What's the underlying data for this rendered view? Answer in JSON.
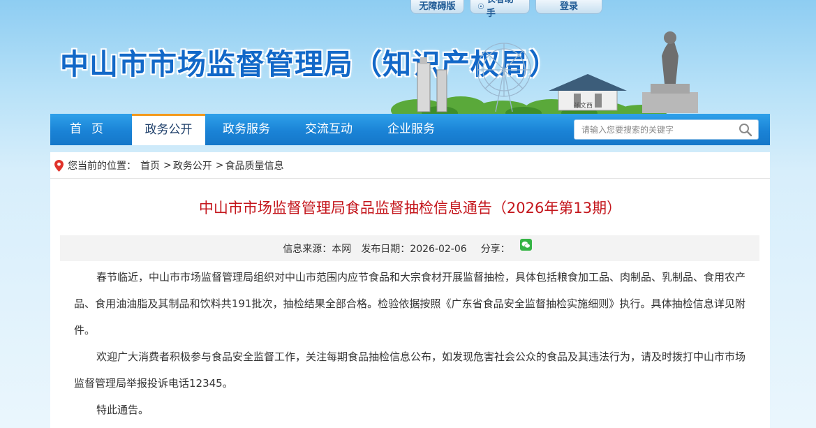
{
  "top_links": {
    "accessibility": "无障碍版",
    "elder": "长者助手",
    "login": "登录"
  },
  "site_title": "中山市市场监督管理局（知识产权局）",
  "nav": {
    "items": [
      "首页",
      "政务公开",
      "政务服务",
      "交流互动",
      "企业服务"
    ],
    "active": "政务公开",
    "search_placeholder": "请输入您要搜索的关键字"
  },
  "breadcrumb": {
    "label": "您当前的位置：",
    "items": [
      "首页",
      "政务公开",
      "食品质量信息"
    ]
  },
  "article": {
    "title": "中山市市场监督管理局食品监督抽检信息通告（2026年第13期）",
    "meta": {
      "source": "信息来源：本网",
      "date": "发布日期：2026-02-06",
      "share": "分享："
    },
    "paragraphs": [
      "春节临近，中山市市场监督管理局组织对中山市范围内应节食品和大宗食材开展监督抽检，具体包括粮食加工品、肉制品、乳制品、食用农产品、食用油油脂及其制品和饮料共191批次，抽检结果全部合格。检验依据按照《广东省食品安全监督抽检实施细则》执行。具体抽检信息详见附件。",
      "欢迎广大消费者积极参与食品安全监督工作，关注每期食品抽检信息公布，如发现危害社会公众的食品及其违法行为，请及时拨打中山市市场监督管理局举报投诉电话12345。",
      "特此通告。"
    ]
  },
  "banner_sign": "孫文西",
  "colors": {
    "nav_blue": "#1a83d6",
    "title_red": "#c4161c",
    "active_accent": "#f39a1e",
    "site_title_blue": "#1268c8"
  }
}
